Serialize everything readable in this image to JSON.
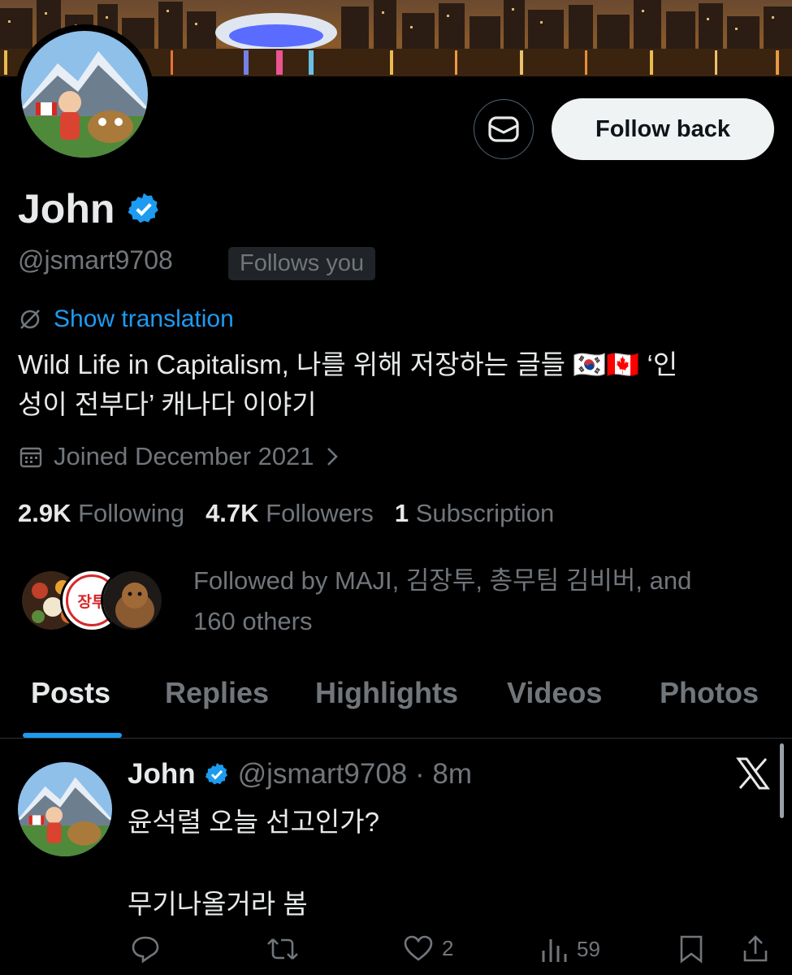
{
  "profile": {
    "name": "John",
    "handle": "@jsmart9708",
    "follows_you": "Follows you",
    "show_translation": "Show translation",
    "bio_line1": "Wild Life in Capitalism, 나를 위해 저장하는 글들 🇰🇷🇨🇦 ‘인",
    "bio_line2": "성이 전부다’ 캐나다 이야기",
    "joined": "Joined December 2021",
    "following_count": "2.9K",
    "following_label": "Following",
    "followers_count": "4.7K",
    "followers_label": "Followers",
    "subscription_count": "1",
    "subscription_label": "Subscription",
    "followed_by_line1": "Followed by MAJI, 김장투, 총무팀 김비버, and",
    "followed_by_line2": "160 others",
    "mini_avatar_text": "장투"
  },
  "actions": {
    "follow_back": "Follow back"
  },
  "tabs": [
    "Posts",
    "Replies",
    "Highlights",
    "Videos",
    "Photos"
  ],
  "post": {
    "name": "John",
    "meta": "@jsmart9708 · 8m",
    "text1": "윤석렬 오늘 선고인가?",
    "text2": "무기나올거라 봄",
    "likes": "2",
    "views": "59"
  },
  "colors": {
    "accent": "#1d9bf0",
    "muted": "#71767b",
    "text": "#e7e9ea",
    "background": "#000000"
  },
  "icons": [
    "envelope-icon",
    "verified-badge-icon",
    "translate-icon",
    "calendar-icon",
    "chevron-right-icon",
    "x-logo-icon",
    "reply-icon",
    "retweet-icon",
    "heart-icon",
    "views-icon",
    "bookmark-icon",
    "share-icon"
  ]
}
